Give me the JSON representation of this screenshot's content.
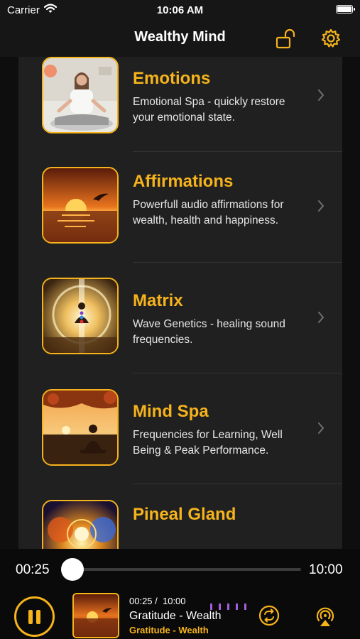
{
  "status_bar": {
    "carrier": "Carrier",
    "time": "10:06 AM"
  },
  "nav": {
    "title": "Wealthy Mind",
    "lock_icon": "unlock-icon",
    "settings_icon": "gear-icon"
  },
  "colors": {
    "accent": "#f5b31c",
    "background": "#0e0e0e",
    "panel": "#202020",
    "equalizer": "#a45de0"
  },
  "categories": [
    {
      "title": "Emotions",
      "description": "Emotional Spa - quickly restore your emotional state."
    },
    {
      "title": "Affirmations",
      "description": "Powerfull audio affirmations for wealth, health and happiness."
    },
    {
      "title": "Matrix",
      "description": "Wave Genetics - healing sound frequencies."
    },
    {
      "title": "Mind Spa",
      "description": "Frequencies for Learning, Well Being & Peak Performance."
    },
    {
      "title": "Pineal Gland",
      "description": ""
    }
  ],
  "player": {
    "elapsed": "00:25",
    "total": "10:00",
    "progress": 0.042,
    "now_playing_time": "00:25 /  10:00",
    "track_title": "Gratitude - Wealth",
    "track_subtitle": "Gratitude - Wealth",
    "state": "playing"
  }
}
